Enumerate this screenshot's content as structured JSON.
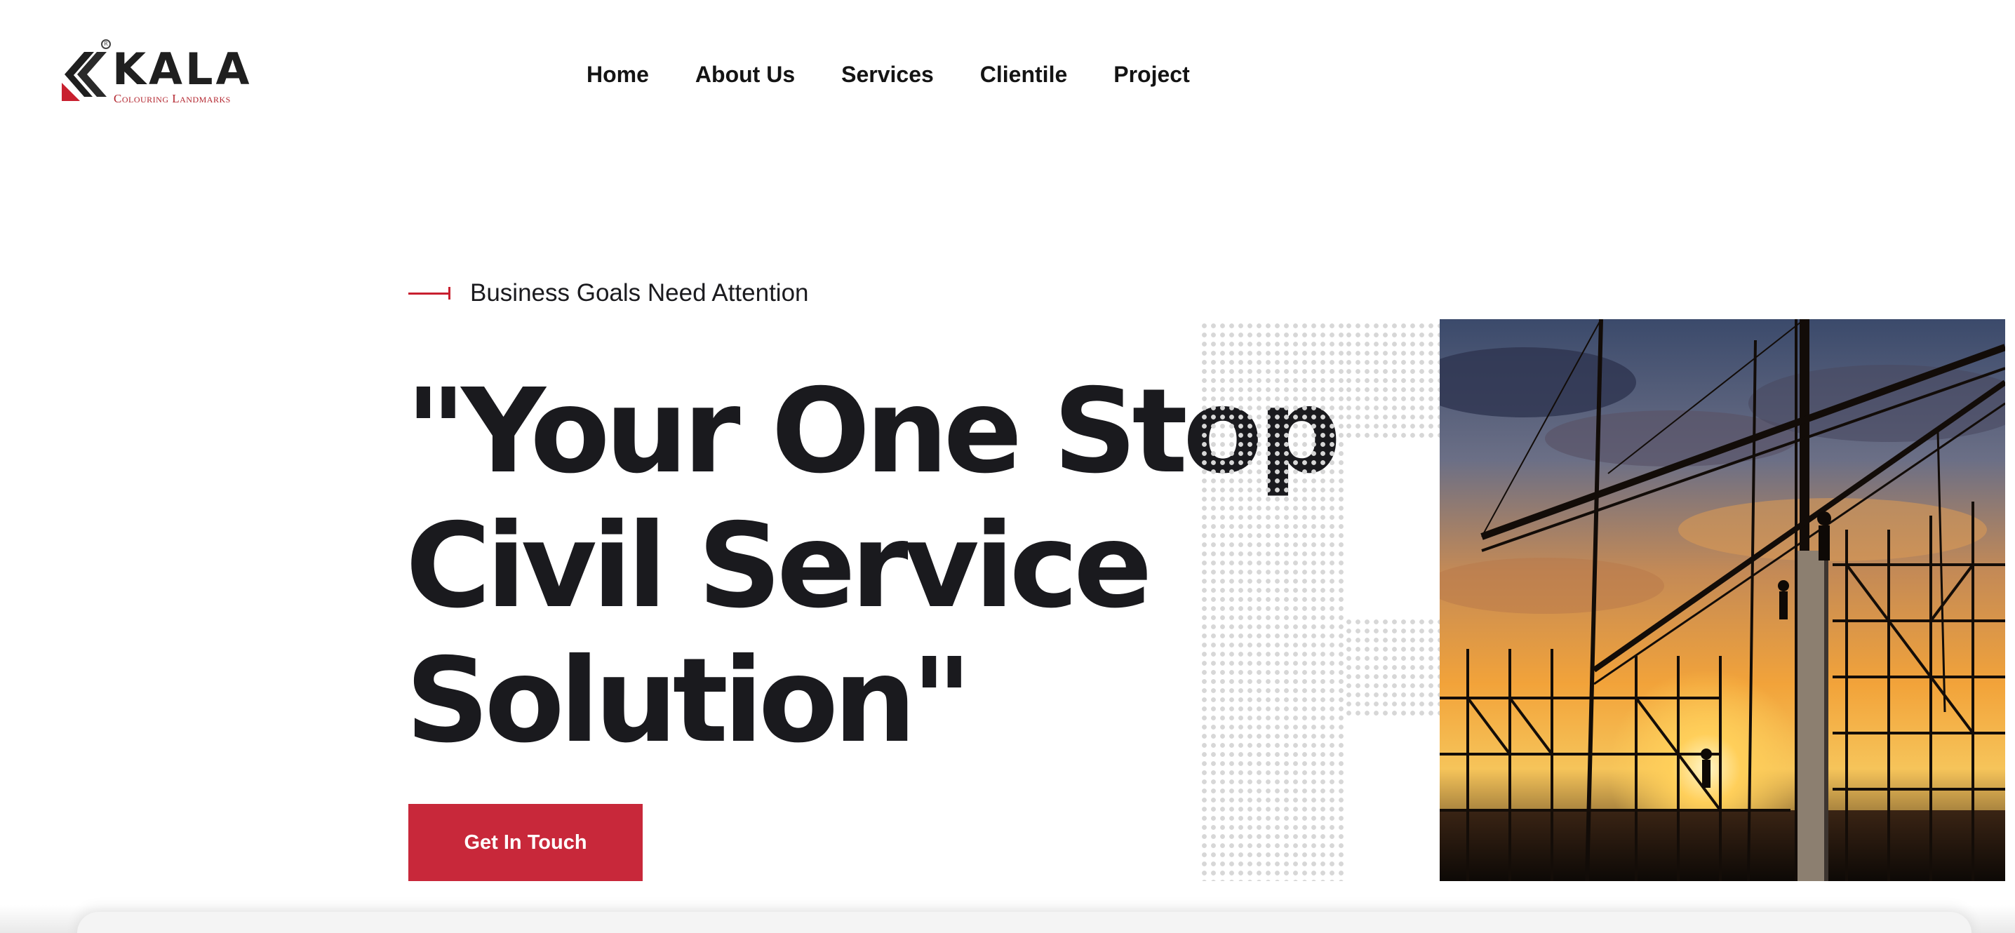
{
  "brand": {
    "name": "KALA",
    "tagline": "Colouring Landmarks",
    "registered_mark": "R",
    "accent_color": "#c8283a"
  },
  "nav": {
    "items": [
      {
        "label": "Home"
      },
      {
        "label": "About Us"
      },
      {
        "label": "Services"
      },
      {
        "label": "Clientile"
      },
      {
        "label": "Project"
      }
    ]
  },
  "hero": {
    "eyebrow": "Business Goals Need Attention",
    "headline_lines": [
      "\"Your One Stop",
      "Civil Service",
      "Solution\""
    ],
    "cta_label": "Get In Touch"
  },
  "icons": {
    "logo_mark": "kala-chevron-logo-icon",
    "eyebrow_marker": "red-line-marker-icon"
  }
}
